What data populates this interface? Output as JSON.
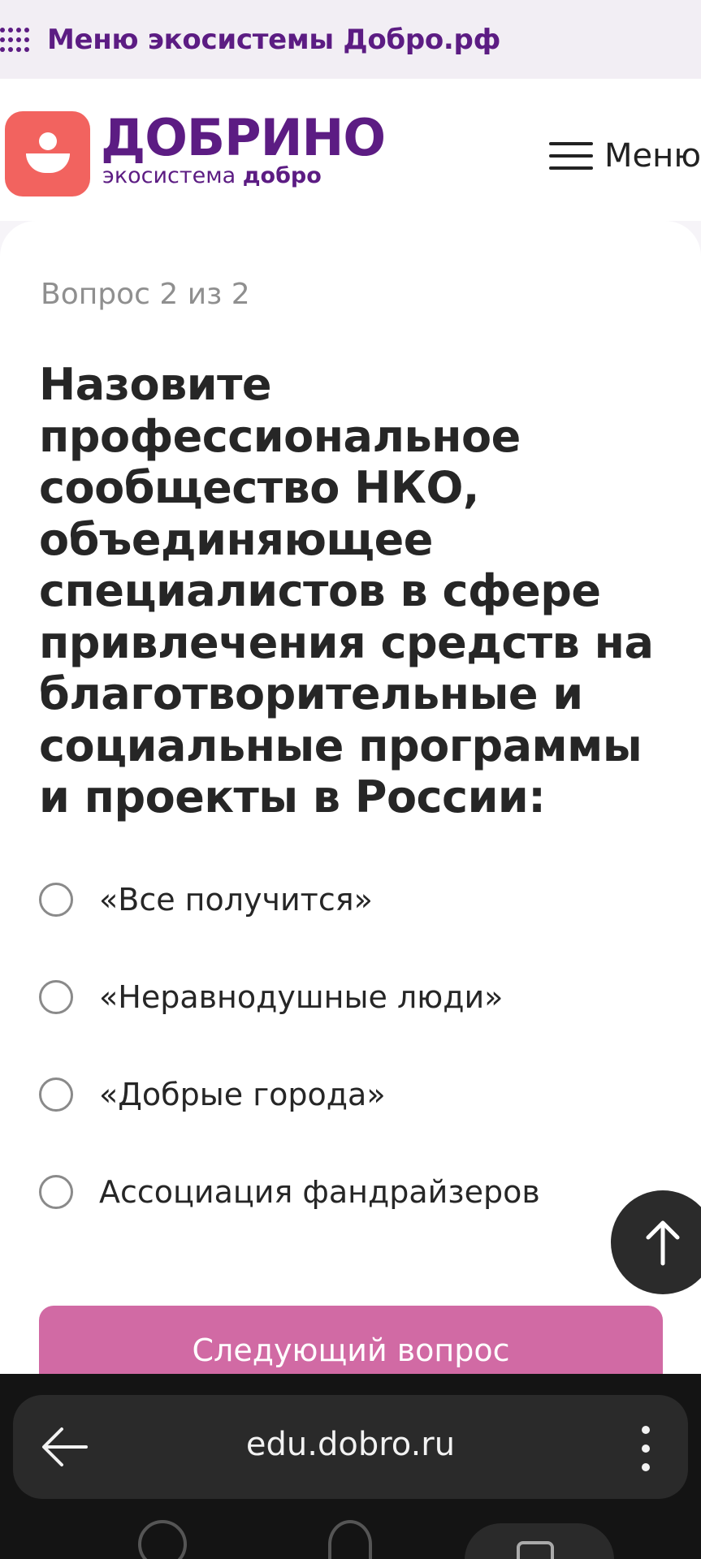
{
  "eco_bar": {
    "title": "Меню экосистемы Добро.рф",
    "accent": "#5c1c83"
  },
  "header": {
    "logo_name": "ДОБРИНО",
    "logo_sub_prefix": "экосистема ",
    "logo_sub_brand": "добро",
    "menu_label": "Меню",
    "logo_color": "#f2635f"
  },
  "quiz": {
    "counter": "Вопрос 2 из 2",
    "question": "Назовите профессиональное сообщество НКО, объединяющее специалистов в сфере привлечения средств на благотворительные и социальные программы и проекты в России:",
    "options": [
      {
        "label": "«Все получится»",
        "selected": false
      },
      {
        "label": "«Неравнодушные люди»",
        "selected": false
      },
      {
        "label": "«Добрые города»",
        "selected": false
      },
      {
        "label": "Ассоциация фандрайзеров",
        "selected": false
      }
    ],
    "next_button": "Следующий вопрос",
    "button_color": "#d16aa4"
  },
  "browser": {
    "url": "edu.dobro.ru",
    "back_icon": "back-arrow-icon",
    "menu_icon": "kebab-menu-icon"
  }
}
